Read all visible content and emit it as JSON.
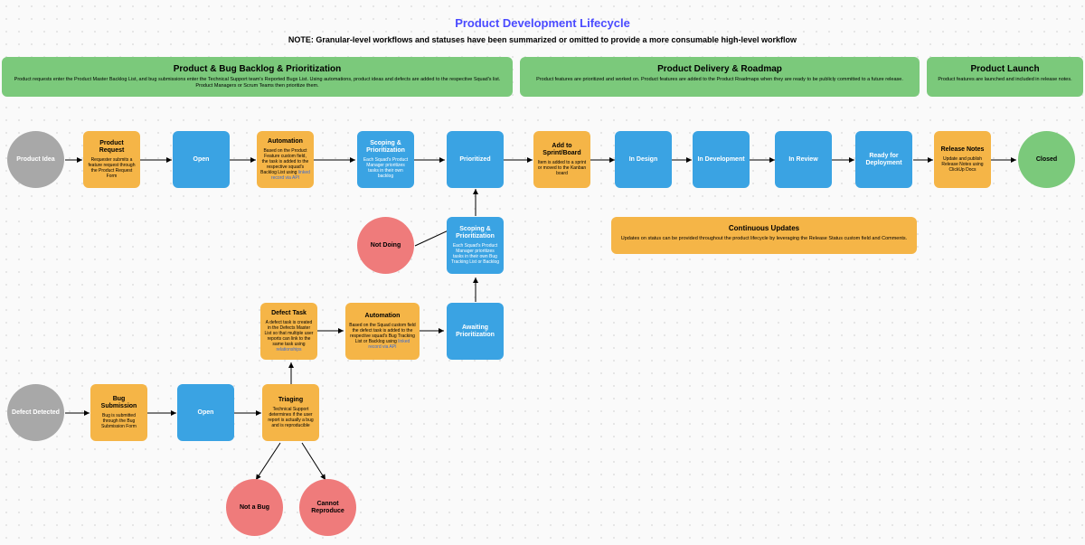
{
  "title": "Product Development Lifecycle",
  "note": "NOTE: Granular-level workflows and statuses have been summarized or omitted to provide a more consumable high-level workflow",
  "phases": {
    "p1": {
      "title": "Product & Bug Backlog & Prioritization",
      "desc": "Product requests enter the Product Master Backlog List, and bug submissions enter the Technical Support team's Reported Bugs List. Using automations, product ideas and defects are added to the respective Squad's list. Product Managers or Scrum Teams then prioritize them."
    },
    "p2": {
      "title": "Product Delivery & Roadmap",
      "desc": "Product features are prioritized and worked on. Product features are added to the Product Roadmaps when they are ready to be publicly committed to a future release."
    },
    "p3": {
      "title": "Product Launch",
      "desc": "Product features are launched and included in release notes."
    }
  },
  "nodes": {
    "idea": "Product Idea",
    "request": {
      "t": "Product Request",
      "s": "Requester submits a feature request through the Product Request Form"
    },
    "open1": "Open",
    "auto1": {
      "t": "Automation",
      "s": "Based on the Product Feature custom field, the task is added to the respective squad's Backlog List using "
    },
    "auto1link": "linked record via API",
    "scope1": {
      "t": "Scoping & Prioritization",
      "s": "Each Squad's Product Manager prioritizes tasks in their own backlog"
    },
    "prioritized": "Prioritized",
    "addsprint": {
      "t": "Add to Sprint/Board",
      "s": "Item is added to a sprint or moved to the Kanban board"
    },
    "indesign": "In Design",
    "indev": "In Development",
    "inreview": "In Review",
    "ready": "Ready for Deployment",
    "relnotes": {
      "t": "Release Notes",
      "s": "Update and publish Release Notes using ClickUp Docs"
    },
    "closed": "Closed",
    "notdoing": "Not Doing",
    "scope2": {
      "t": "Scoping & Prioritization",
      "s": "Each Squad's Product Manager prioritizes tasks in their own Bug Tracking List or Backlog"
    },
    "continuous": {
      "t": "Continuous Updates",
      "s": "Updates on status can be provided throughout the product lifecycle by leveraging the Release Status custom field and Comments."
    },
    "defecttask": {
      "t": "Defect Task",
      "s": "A defect task is created in the Defects Master List so that multiple user reports can link to the same task using "
    },
    "defectlink": "relationships",
    "auto2": {
      "t": "Automation",
      "s": "Based on the Squad custom field the defect task is added to the respective squad's Bug Tracking List or Backlog using "
    },
    "auto2link": "linked record via API",
    "awaiting": "Awaiting Prioritization",
    "defectdet": "Defect Detected",
    "bugsub": {
      "t": "Bug Submission",
      "s": "Bug is submitted through the Bug Submission Form"
    },
    "open2": "Open",
    "triaging": {
      "t": "Triaging",
      "s": "Technical Support determines if the user report is actually a bug and is reproducible"
    },
    "notabug": "Not a Bug",
    "cannot": "Cannot Reproduce"
  }
}
